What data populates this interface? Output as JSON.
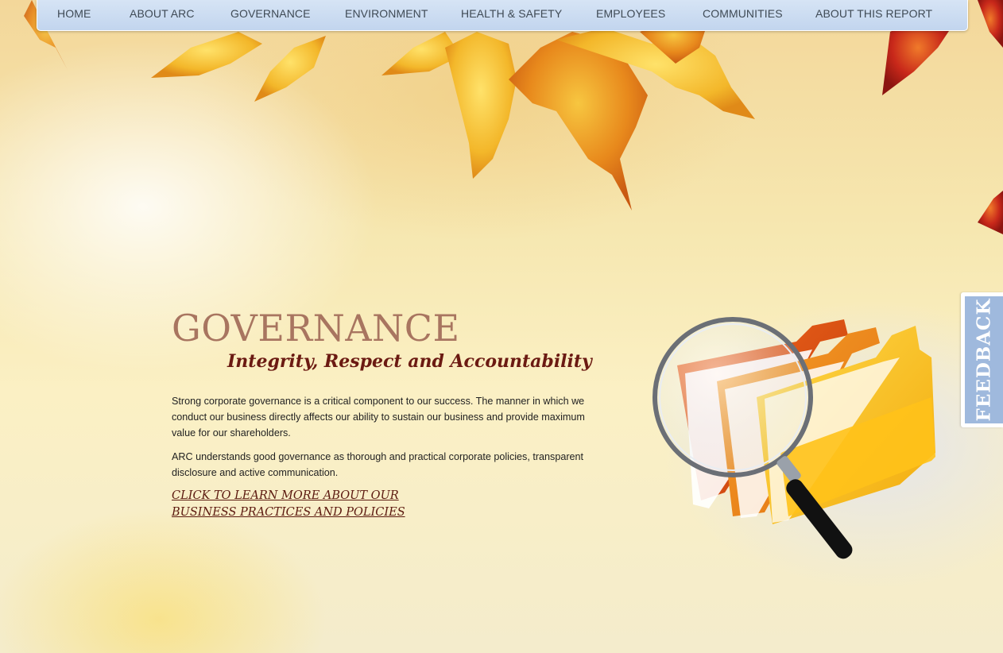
{
  "nav": {
    "items": [
      {
        "label": "HOME"
      },
      {
        "label": "ABOUT ARC"
      },
      {
        "label": "GOVERNANCE"
      },
      {
        "label": "ENVIRONMENT"
      },
      {
        "label": "HEALTH & SAFETY"
      },
      {
        "label": "EMPLOYEES"
      },
      {
        "label": "COMMUNITIES"
      },
      {
        "label": "ABOUT THIS REPORT"
      }
    ]
  },
  "hero": {
    "title": "GOVERNANCE",
    "subtitle": "Integrity, Respect and Accountability",
    "paragraph1": "Strong corporate governance is a critical component to our success. The manner in which we conduct our business directly affects our ability to sustain our business and provide maximum value for our shareholders.",
    "paragraph2": "ARC understands good governance as thorough and practical corporate policies, transparent disclosure and active communication.",
    "link_line1": "CLICK TO LEARN MORE ABOUT OUR ",
    "link_line2": "BUSINESS PRACTICES AND POLICIES"
  },
  "feedback": {
    "label": "FEEDBACK"
  },
  "colors": {
    "nav_bg": "#c8d9f0",
    "title": "#a87560",
    "subtitle": "#6b1a12",
    "link": "#5c1a10",
    "feedback_tab": "#9fb9dd"
  },
  "icons": [
    "autumn-leaves-image",
    "folders-magnifier-image"
  ]
}
